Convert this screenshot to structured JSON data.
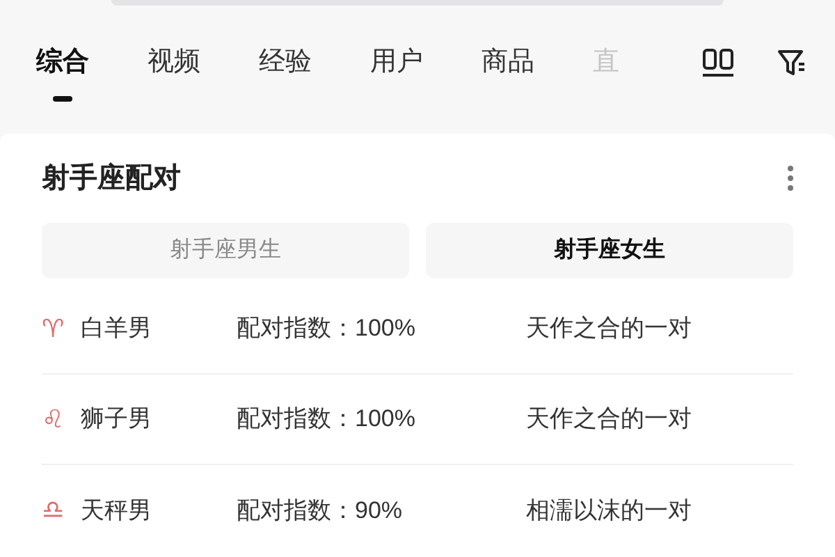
{
  "tabs": [
    {
      "label": "综合",
      "selected": true,
      "faded": false
    },
    {
      "label": "视频",
      "selected": false,
      "faded": false
    },
    {
      "label": "经验",
      "selected": false,
      "faded": false
    },
    {
      "label": "用户",
      "selected": false,
      "faded": false
    },
    {
      "label": "商品",
      "selected": false,
      "faded": false
    },
    {
      "label": "直",
      "selected": false,
      "faded": true
    }
  ],
  "card": {
    "title": "射手座配对",
    "segments": [
      {
        "label": "射手座男生",
        "selected": false
      },
      {
        "label": "射手座女生",
        "selected": true
      }
    ],
    "rows": [
      {
        "sign": "♈",
        "name": "白羊男",
        "index": "配对指数：100%",
        "verdict": "天作之合的一对"
      },
      {
        "sign": "♌",
        "name": "狮子男",
        "index": "配对指数：100%",
        "verdict": "天作之合的一对"
      },
      {
        "sign": "♎",
        "name": "天秤男",
        "index": "配对指数：90%",
        "verdict": "相濡以沫的一对"
      }
    ]
  }
}
